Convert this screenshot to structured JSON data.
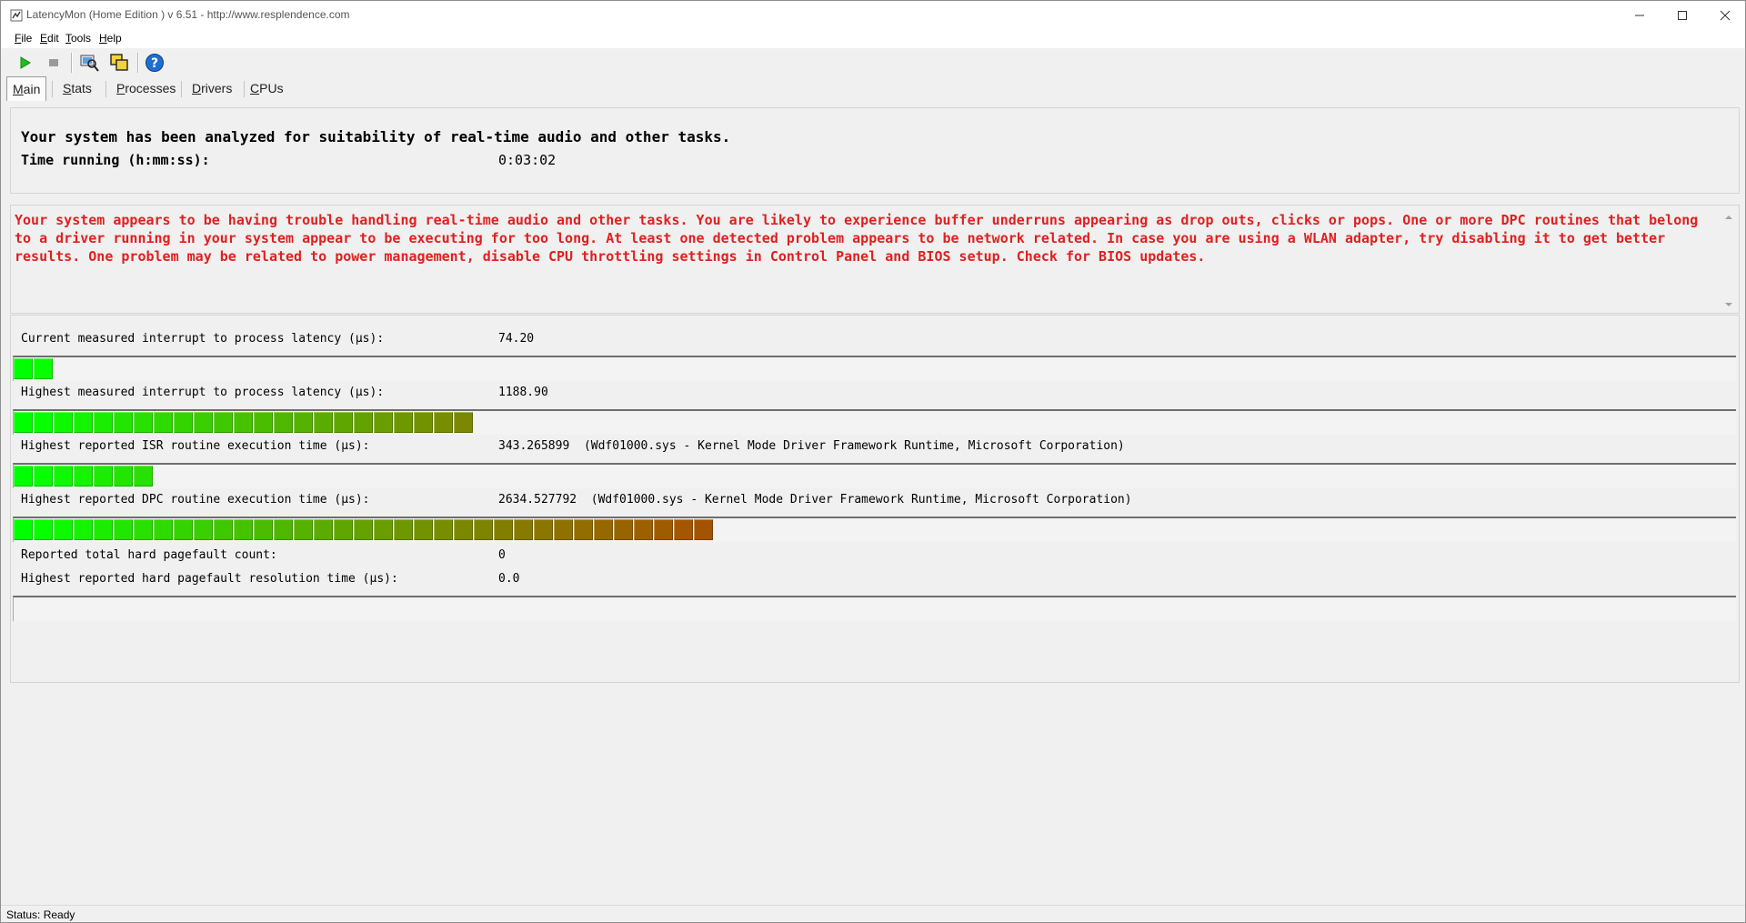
{
  "window": {
    "title": "LatencyMon  (Home Edition )  v 6.51 - http://www.resplendence.com"
  },
  "menu": [
    {
      "accel": "F",
      "rest": "ile"
    },
    {
      "accel": "E",
      "rest": "dit"
    },
    {
      "accel": "T",
      "rest": "ools"
    },
    {
      "accel": "H",
      "rest": "elp"
    }
  ],
  "toolbar": {
    "icons": [
      "play-icon",
      "stop-icon",
      "analyze-icon",
      "windows-icon",
      "help-icon"
    ],
    "accent_play": "#1fbe1f",
    "accent_help": "#1f6fd1"
  },
  "tabs": [
    {
      "accel": "M",
      "rest": "ain",
      "active": true
    },
    {
      "accel": "S",
      "rest": "tats",
      "active": false
    },
    {
      "accel": "P",
      "rest": "rocesses",
      "active": false
    },
    {
      "accel": "D",
      "rest": "rivers",
      "active": false
    },
    {
      "accel": "C",
      "rest": "PUs",
      "active": false
    }
  ],
  "summary": {
    "headline": "Your system has been analyzed for suitability of real-time audio and other tasks.",
    "time_label": "Time running (h:mm:ss):",
    "time_value": "0:03:02"
  },
  "warning": {
    "text": "Your system appears to be having trouble handling real-time audio and other tasks. You are likely to experience buffer underruns appearing as drop outs, clicks or pops. One or more DPC routines that belong to a driver running in your system appear to be executing for too long. At least one detected problem appears to be network related. In case you are using a WLAN adapter, try disabling it to get better results. One problem may be related to power management, disable CPU throttling settings in Control Panel and BIOS setup. Check for BIOS updates.",
    "color": "#e02020"
  },
  "metrics": {
    "current_latency": {
      "label": "Current measured interrupt to process latency (µs):",
      "value": "74.20",
      "segments": 2
    },
    "highest_latency": {
      "label": "Highest measured interrupt to process latency (µs):",
      "value": "1188.90",
      "segments": 23
    },
    "isr": {
      "label": "Highest reported ISR routine execution time (µs):",
      "value": "343.265899",
      "driver": "(Wdf01000.sys - Kernel Mode Driver Framework Runtime, Microsoft Corporation)",
      "segments": 7
    },
    "dpc": {
      "label": "Highest reported DPC routine execution time (µs):",
      "value": "2634.527792",
      "driver": "(Wdf01000.sys - Kernel Mode Driver Framework Runtime, Microsoft Corporation)",
      "segments": 35
    },
    "pagefault_count": {
      "label": "Reported total hard pagefault count:",
      "value": "0"
    },
    "pagefault_time": {
      "label": "Highest reported hard pagefault resolution time (µs):",
      "value": "0.0",
      "segments": 0
    }
  },
  "status": {
    "text": "Status: Ready"
  }
}
